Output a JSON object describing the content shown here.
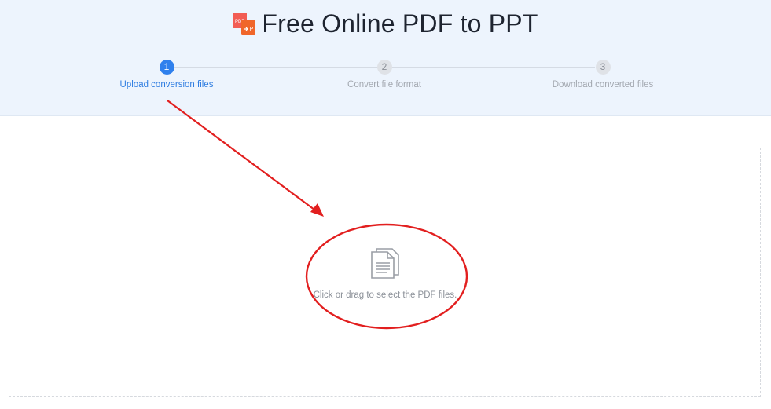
{
  "header": {
    "title": "Free Online PDF to PPT",
    "logo_icon": "pdf-to-ppt-icon",
    "logo_texts": {
      "pdf": "PDF",
      "p": "P"
    },
    "background": "#edf4fd"
  },
  "steps": [
    {
      "number": "1",
      "label": "Upload conversion files",
      "active": true
    },
    {
      "number": "2",
      "label": "Convert file format",
      "active": false
    },
    {
      "number": "3",
      "label": "Download converted files",
      "active": false
    }
  ],
  "upload": {
    "icon": "document-icon",
    "prompt": "Click or drag to select the PDF files."
  },
  "colors": {
    "accent": "#2f80ed",
    "annotation": "#e21f1f",
    "inactive_step": "#dfe2e7"
  }
}
